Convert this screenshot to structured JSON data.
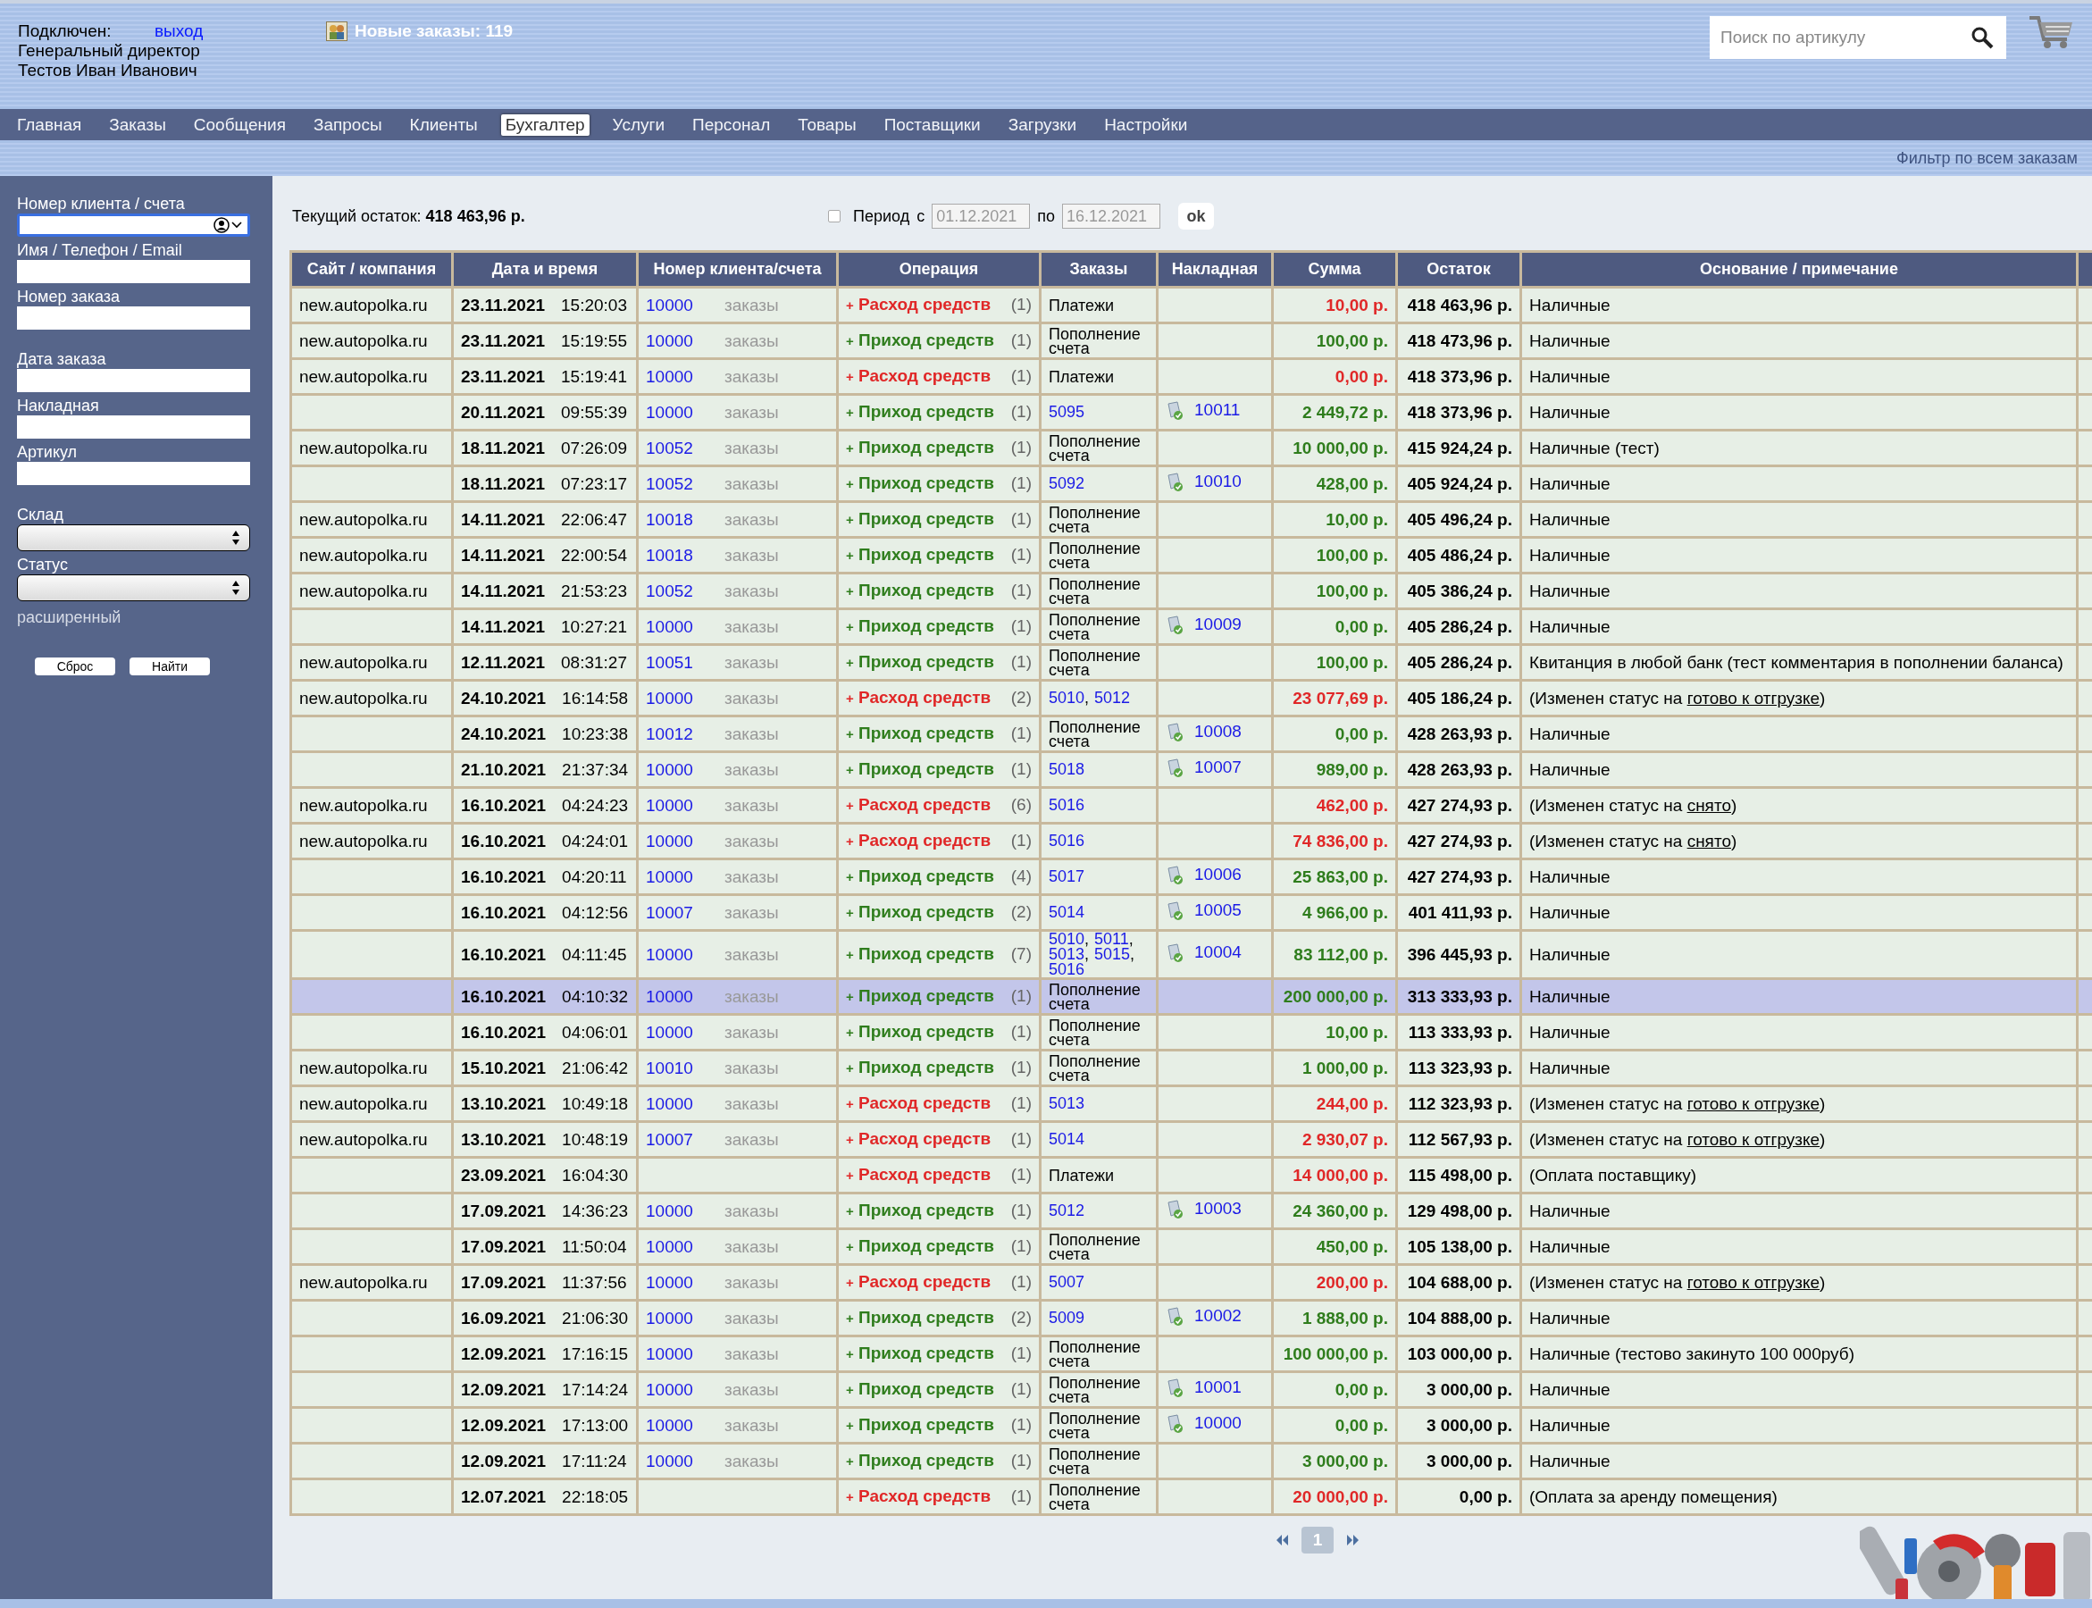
{
  "header": {
    "status": "Подключен:",
    "logout": "выход",
    "role": "Генеральный директор",
    "user": "Тестов Иван Иванович",
    "new_orders": "Новые заказы: 119",
    "search": {
      "placeholder": "Поиск по артикулу"
    }
  },
  "nav": [
    {
      "label": "Главная",
      "selected": false
    },
    {
      "label": "Заказы",
      "selected": false
    },
    {
      "label": "Сообщения",
      "selected": false
    },
    {
      "label": "Запросы",
      "selected": false
    },
    {
      "label": "Клиенты",
      "selected": false
    },
    {
      "label": "Бухгалтер",
      "selected": true
    },
    {
      "label": "Услуги",
      "selected": false
    },
    {
      "label": "Персонал",
      "selected": false
    },
    {
      "label": "Товары",
      "selected": false
    },
    {
      "label": "Поставщики",
      "selected": false
    },
    {
      "label": "Загрузки",
      "selected": false
    },
    {
      "label": "Настройки",
      "selected": false
    }
  ],
  "filter_link": "Фильтр по всем заказам",
  "sidebar": {
    "groups": [
      [
        {
          "label": "Номер клиента / счета",
          "kind": "combo",
          "focused": true
        },
        {
          "label": "Имя / Телефон / Email",
          "kind": "input",
          "focused": false
        },
        {
          "label": "Номер заказа",
          "kind": "input",
          "focused": false
        }
      ],
      [
        {
          "label": "Дата заказа",
          "kind": "input",
          "focused": false
        },
        {
          "label": "Накладная",
          "kind": "input",
          "focused": false
        },
        {
          "label": "Артикул",
          "kind": "input",
          "focused": false
        }
      ],
      [
        {
          "label": "Склад",
          "kind": "select",
          "focused": false
        },
        {
          "label": "Статус",
          "kind": "select",
          "focused": false
        }
      ]
    ],
    "advanced": "расширенный",
    "buttons": [
      "Сброс",
      "Найти"
    ]
  },
  "balance": {
    "label": "Текущий остаток:",
    "value": "418 463,96 р."
  },
  "period": {
    "checked": false,
    "label": "Период",
    "from_label": "с",
    "from": "01.12.2021",
    "to_label": "по",
    "to": "16.12.2021",
    "button": "ok"
  },
  "table": {
    "order_separator": ",",
    "columns": [
      "Сайт / компания",
      "Дата и время",
      "Номер клиента/счета",
      "Операция",
      "Заказы",
      "Накладная",
      "Сумма",
      "Остаток",
      "Основание / примечание"
    ],
    "rows": [
      {
        "site": "new.autopolka.ru",
        "date": "23.11.2021",
        "time": "15:20:03",
        "client": "10000",
        "orders_link": "заказы",
        "kind": "expense",
        "sign": "+",
        "operation": "Расход средств",
        "count": "(1)",
        "orders_text": "Платежи",
        "sum": "10,00 р.",
        "balance": "418 463,96 р.",
        "note": "Наличные",
        "selected": false
      },
      {
        "site": "new.autopolka.ru",
        "date": "23.11.2021",
        "time": "15:19:55",
        "client": "10000",
        "orders_link": "заказы",
        "kind": "income",
        "sign": "+",
        "operation": "Приход средств",
        "count": "(1)",
        "orders_text": "Пополнение счета",
        "sum": "100,00 р.",
        "balance": "418 473,96 р.",
        "note": "Наличные",
        "selected": false
      },
      {
        "site": "new.autopolka.ru",
        "date": "23.11.2021",
        "time": "15:19:41",
        "client": "10000",
        "orders_link": "заказы",
        "kind": "expense",
        "sign": "+",
        "operation": "Расход средств",
        "count": "(1)",
        "orders_text": "Платежи",
        "sum": "0,00 р.",
        "balance": "418 373,96 р.",
        "note": "Наличные",
        "selected": false
      },
      {
        "date": "20.11.2021",
        "time": "09:55:39",
        "client": "10000",
        "orders_link": "заказы",
        "kind": "income",
        "sign": "+",
        "operation": "Приход средств",
        "count": "(1)",
        "order_links": [
          "5095"
        ],
        "invoice": "10011",
        "sum": "2 449,72 р.",
        "balance": "418 373,96 р.",
        "note": "Наличные",
        "selected": false
      },
      {
        "site": "new.autopolka.ru",
        "date": "18.11.2021",
        "time": "07:26:09",
        "client": "10052",
        "orders_link": "заказы",
        "kind": "income",
        "sign": "+",
        "operation": "Приход средств",
        "count": "(1)",
        "orders_text": "Пополнение счета",
        "sum": "10 000,00 р.",
        "balance": "415 924,24 р.",
        "note": "Наличные (тест)",
        "selected": false
      },
      {
        "date": "18.11.2021",
        "time": "07:23:17",
        "client": "10052",
        "orders_link": "заказы",
        "kind": "income",
        "sign": "+",
        "operation": "Приход средств",
        "count": "(1)",
        "order_links": [
          "5092"
        ],
        "invoice": "10010",
        "sum": "428,00 р.",
        "balance": "405 924,24 р.",
        "note": "Наличные",
        "selected": false
      },
      {
        "site": "new.autopolka.ru",
        "date": "14.11.2021",
        "time": "22:06:47",
        "client": "10018",
        "orders_link": "заказы",
        "kind": "income",
        "sign": "+",
        "operation": "Приход средств",
        "count": "(1)",
        "orders_text": "Пополнение счета",
        "sum": "10,00 р.",
        "balance": "405 496,24 р.",
        "note": "Наличные",
        "selected": false
      },
      {
        "site": "new.autopolka.ru",
        "date": "14.11.2021",
        "time": "22:00:54",
        "client": "10018",
        "orders_link": "заказы",
        "kind": "income",
        "sign": "+",
        "operation": "Приход средств",
        "count": "(1)",
        "orders_text": "Пополнение счета",
        "sum": "100,00 р.",
        "balance": "405 486,24 р.",
        "note": "Наличные",
        "selected": false
      },
      {
        "site": "new.autopolka.ru",
        "date": "14.11.2021",
        "time": "21:53:23",
        "client": "10052",
        "orders_link": "заказы",
        "kind": "income",
        "sign": "+",
        "operation": "Приход средств",
        "count": "(1)",
        "orders_text": "Пополнение счета",
        "sum": "100,00 р.",
        "balance": "405 386,24 р.",
        "note": "Наличные",
        "selected": false
      },
      {
        "date": "14.11.2021",
        "time": "10:27:21",
        "client": "10000",
        "orders_link": "заказы",
        "kind": "income",
        "sign": "+",
        "operation": "Приход средств",
        "count": "(1)",
        "orders_text": "Пополнение счета",
        "invoice": "10009",
        "sum": "0,00 р.",
        "balance": "405 286,24 р.",
        "note": "Наличные",
        "selected": false
      },
      {
        "site": "new.autopolka.ru",
        "date": "12.11.2021",
        "time": "08:31:27",
        "client": "10051",
        "orders_link": "заказы",
        "kind": "income",
        "sign": "+",
        "operation": "Приход средств",
        "count": "(1)",
        "orders_text": "Пополнение счета",
        "sum": "100,00 р.",
        "balance": "405 286,24 р.",
        "note": "Квитанция в любой банк (тест комментария в пополнении баланса)",
        "selected": false
      },
      {
        "site": "new.autopolka.ru",
        "date": "24.10.2021",
        "time": "16:14:58",
        "client": "10000",
        "orders_link": "заказы",
        "kind": "expense",
        "sign": "+",
        "operation": "Расход средств",
        "count": "(2)",
        "order_links": [
          "5010",
          "5012"
        ],
        "sum": "23 077,69 р.",
        "balance": "405 186,24 р.",
        "note": "(Изменен статус на ",
        "note_link": "готово к отгрузке",
        "note_tail": ")",
        "selected": false
      },
      {
        "date": "24.10.2021",
        "time": "10:23:38",
        "client": "10012",
        "orders_link": "заказы",
        "kind": "income",
        "sign": "+",
        "operation": "Приход средств",
        "count": "(1)",
        "orders_text": "Пополнение счета",
        "invoice": "10008",
        "sum": "0,00 р.",
        "balance": "428 263,93 р.",
        "note": "Наличные",
        "selected": false
      },
      {
        "date": "21.10.2021",
        "time": "21:37:34",
        "client": "10000",
        "orders_link": "заказы",
        "kind": "income",
        "sign": "+",
        "operation": "Приход средств",
        "count": "(1)",
        "order_links": [
          "5018"
        ],
        "invoice": "10007",
        "sum": "989,00 р.",
        "balance": "428 263,93 р.",
        "note": "Наличные",
        "selected": false
      },
      {
        "site": "new.autopolka.ru",
        "date": "16.10.2021",
        "time": "04:24:23",
        "client": "10000",
        "orders_link": "заказы",
        "kind": "expense",
        "sign": "+",
        "operation": "Расход средств",
        "count": "(6)",
        "order_links": [
          "5016"
        ],
        "sum": "462,00 р.",
        "balance": "427 274,93 р.",
        "note": "(Изменен статус на ",
        "note_link": "снято",
        "note_tail": ")",
        "selected": false
      },
      {
        "site": "new.autopolka.ru",
        "date": "16.10.2021",
        "time": "04:24:01",
        "client": "10000",
        "orders_link": "заказы",
        "kind": "expense",
        "sign": "+",
        "operation": "Расход средств",
        "count": "(1)",
        "order_links": [
          "5016"
        ],
        "sum": "74 836,00 р.",
        "balance": "427 274,93 р.",
        "note": "(Изменен статус на ",
        "note_link": "снято",
        "note_tail": ")",
        "selected": false
      },
      {
        "date": "16.10.2021",
        "time": "04:20:11",
        "client": "10000",
        "orders_link": "заказы",
        "kind": "income",
        "sign": "+",
        "operation": "Приход средств",
        "count": "(4)",
        "order_links": [
          "5017"
        ],
        "invoice": "10006",
        "sum": "25 863,00 р.",
        "balance": "427 274,93 р.",
        "note": "Наличные",
        "selected": false
      },
      {
        "date": "16.10.2021",
        "time": "04:12:56",
        "client": "10007",
        "orders_link": "заказы",
        "kind": "income",
        "sign": "+",
        "operation": "Приход средств",
        "count": "(2)",
        "order_links": [
          "5014"
        ],
        "invoice": "10005",
        "sum": "4 966,00 р.",
        "balance": "401 411,93 р.",
        "note": "Наличные",
        "selected": false
      },
      {
        "date": "16.10.2021",
        "time": "04:11:45",
        "client": "10000",
        "orders_link": "заказы",
        "kind": "income",
        "sign": "+",
        "operation": "Приход средств",
        "count": "(7)",
        "order_links": [
          "5010",
          "5011",
          "5013",
          "5015",
          "5016"
        ],
        "invoice": "10004",
        "sum": "83 112,00 р.",
        "balance": "396 445,93 р.",
        "note": "Наличные",
        "selected": false
      },
      {
        "date": "16.10.2021",
        "time": "04:10:32",
        "client": "10000",
        "orders_link": "заказы",
        "kind": "income",
        "sign": "+",
        "operation": "Приход средств",
        "count": "(1)",
        "orders_text": "Пополнение счета",
        "sum": "200 000,00 р.",
        "balance": "313 333,93 р.",
        "note": "Наличные",
        "selected": true
      },
      {
        "date": "16.10.2021",
        "time": "04:06:01",
        "client": "10000",
        "orders_link": "заказы",
        "kind": "income",
        "sign": "+",
        "operation": "Приход средств",
        "count": "(1)",
        "orders_text": "Пополнение счета",
        "sum": "10,00 р.",
        "balance": "113 333,93 р.",
        "note": "Наличные",
        "selected": false
      },
      {
        "site": "new.autopolka.ru",
        "date": "15.10.2021",
        "time": "21:06:42",
        "client": "10010",
        "orders_link": "заказы",
        "kind": "income",
        "sign": "+",
        "operation": "Приход средств",
        "count": "(1)",
        "orders_text": "Пополнение счета",
        "sum": "1 000,00 р.",
        "balance": "113 323,93 р.",
        "note": "Наличные",
        "selected": false
      },
      {
        "site": "new.autopolka.ru",
        "date": "13.10.2021",
        "time": "10:49:18",
        "client": "10000",
        "orders_link": "заказы",
        "kind": "expense",
        "sign": "+",
        "operation": "Расход средств",
        "count": "(1)",
        "order_links": [
          "5013"
        ],
        "sum": "244,00 р.",
        "balance": "112 323,93 р.",
        "note": "(Изменен статус на ",
        "note_link": "готово к отгрузке",
        "note_tail": ")",
        "selected": false
      },
      {
        "site": "new.autopolka.ru",
        "date": "13.10.2021",
        "time": "10:48:19",
        "client": "10007",
        "orders_link": "заказы",
        "kind": "expense",
        "sign": "+",
        "operation": "Расход средств",
        "count": "(1)",
        "order_links": [
          "5014"
        ],
        "sum": "2 930,07 р.",
        "balance": "112 567,93 р.",
        "note": "(Изменен статус на ",
        "note_link": "готово к отгрузке",
        "note_tail": ")",
        "selected": false
      },
      {
        "date": "23.09.2021",
        "time": "16:04:30",
        "kind": "expense",
        "sign": "+",
        "operation": "Расход средств",
        "count": "(1)",
        "orders_text": "Платежи",
        "sum": "14 000,00 р.",
        "balance": "115 498,00 р.",
        "note": "(Оплата поставщику)",
        "selected": false
      },
      {
        "date": "17.09.2021",
        "time": "14:36:23",
        "client": "10000",
        "orders_link": "заказы",
        "kind": "income",
        "sign": "+",
        "operation": "Приход средств",
        "count": "(1)",
        "order_links": [
          "5012"
        ],
        "invoice": "10003",
        "sum": "24 360,00 р.",
        "balance": "129 498,00 р.",
        "note": "Наличные",
        "selected": false
      },
      {
        "date": "17.09.2021",
        "time": "11:50:04",
        "client": "10000",
        "orders_link": "заказы",
        "kind": "income",
        "sign": "+",
        "operation": "Приход средств",
        "count": "(1)",
        "orders_text": "Пополнение счета",
        "sum": "450,00 р.",
        "balance": "105 138,00 р.",
        "note": "Наличные",
        "selected": false
      },
      {
        "site": "new.autopolka.ru",
        "date": "17.09.2021",
        "time": "11:37:56",
        "client": "10000",
        "orders_link": "заказы",
        "kind": "expense",
        "sign": "+",
        "operation": "Расход средств",
        "count": "(1)",
        "order_links": [
          "5007"
        ],
        "sum": "200,00 р.",
        "balance": "104 688,00 р.",
        "note": "(Изменен статус на ",
        "note_link": "готово к отгрузке",
        "note_tail": ")",
        "selected": false
      },
      {
        "date": "16.09.2021",
        "time": "21:06:30",
        "client": "10000",
        "orders_link": "заказы",
        "kind": "income",
        "sign": "+",
        "operation": "Приход средств",
        "count": "(2)",
        "order_links": [
          "5009"
        ],
        "invoice": "10002",
        "sum": "1 888,00 р.",
        "balance": "104 888,00 р.",
        "note": "Наличные",
        "selected": false
      },
      {
        "date": "12.09.2021",
        "time": "17:16:15",
        "client": "10000",
        "orders_link": "заказы",
        "kind": "income",
        "sign": "+",
        "operation": "Приход средств",
        "count": "(1)",
        "orders_text": "Пополнение счета",
        "sum": "100 000,00 р.",
        "balance": "103 000,00 р.",
        "note": "Наличные (тестово закинуто 100 000руб)",
        "selected": false
      },
      {
        "date": "12.09.2021",
        "time": "17:14:24",
        "client": "10000",
        "orders_link": "заказы",
        "kind": "income",
        "sign": "+",
        "operation": "Приход средств",
        "count": "(1)",
        "orders_text": "Пополнение счета",
        "invoice": "10001",
        "sum": "0,00 р.",
        "balance": "3 000,00 р.",
        "note": "Наличные",
        "selected": false
      },
      {
        "date": "12.09.2021",
        "time": "17:13:00",
        "client": "10000",
        "orders_link": "заказы",
        "kind": "income",
        "sign": "+",
        "operation": "Приход средств",
        "count": "(1)",
        "orders_text": "Пополнение счета",
        "invoice": "10000",
        "sum": "0,00 р.",
        "balance": "3 000,00 р.",
        "note": "Наличные",
        "selected": false
      },
      {
        "date": "12.09.2021",
        "time": "17:11:24",
        "client": "10000",
        "orders_link": "заказы",
        "kind": "income",
        "sign": "+",
        "operation": "Приход средств",
        "count": "(1)",
        "orders_text": "Пополнение счета",
        "sum": "3 000,00 р.",
        "balance": "3 000,00 р.",
        "note": "Наличные",
        "selected": false
      },
      {
        "date": "12.07.2021",
        "time": "22:18:05",
        "kind": "expense",
        "sign": "+",
        "operation": "Расход средств",
        "count": "(1)",
        "orders_text": "Пополнение счета",
        "sum": "20 000,00 р.",
        "balance": "0,00 р.",
        "note": "(Оплата за аренду помещения)",
        "selected": false
      }
    ]
  },
  "pagination": {
    "pages": [
      {
        "label": "1",
        "selected": true
      }
    ]
  }
}
